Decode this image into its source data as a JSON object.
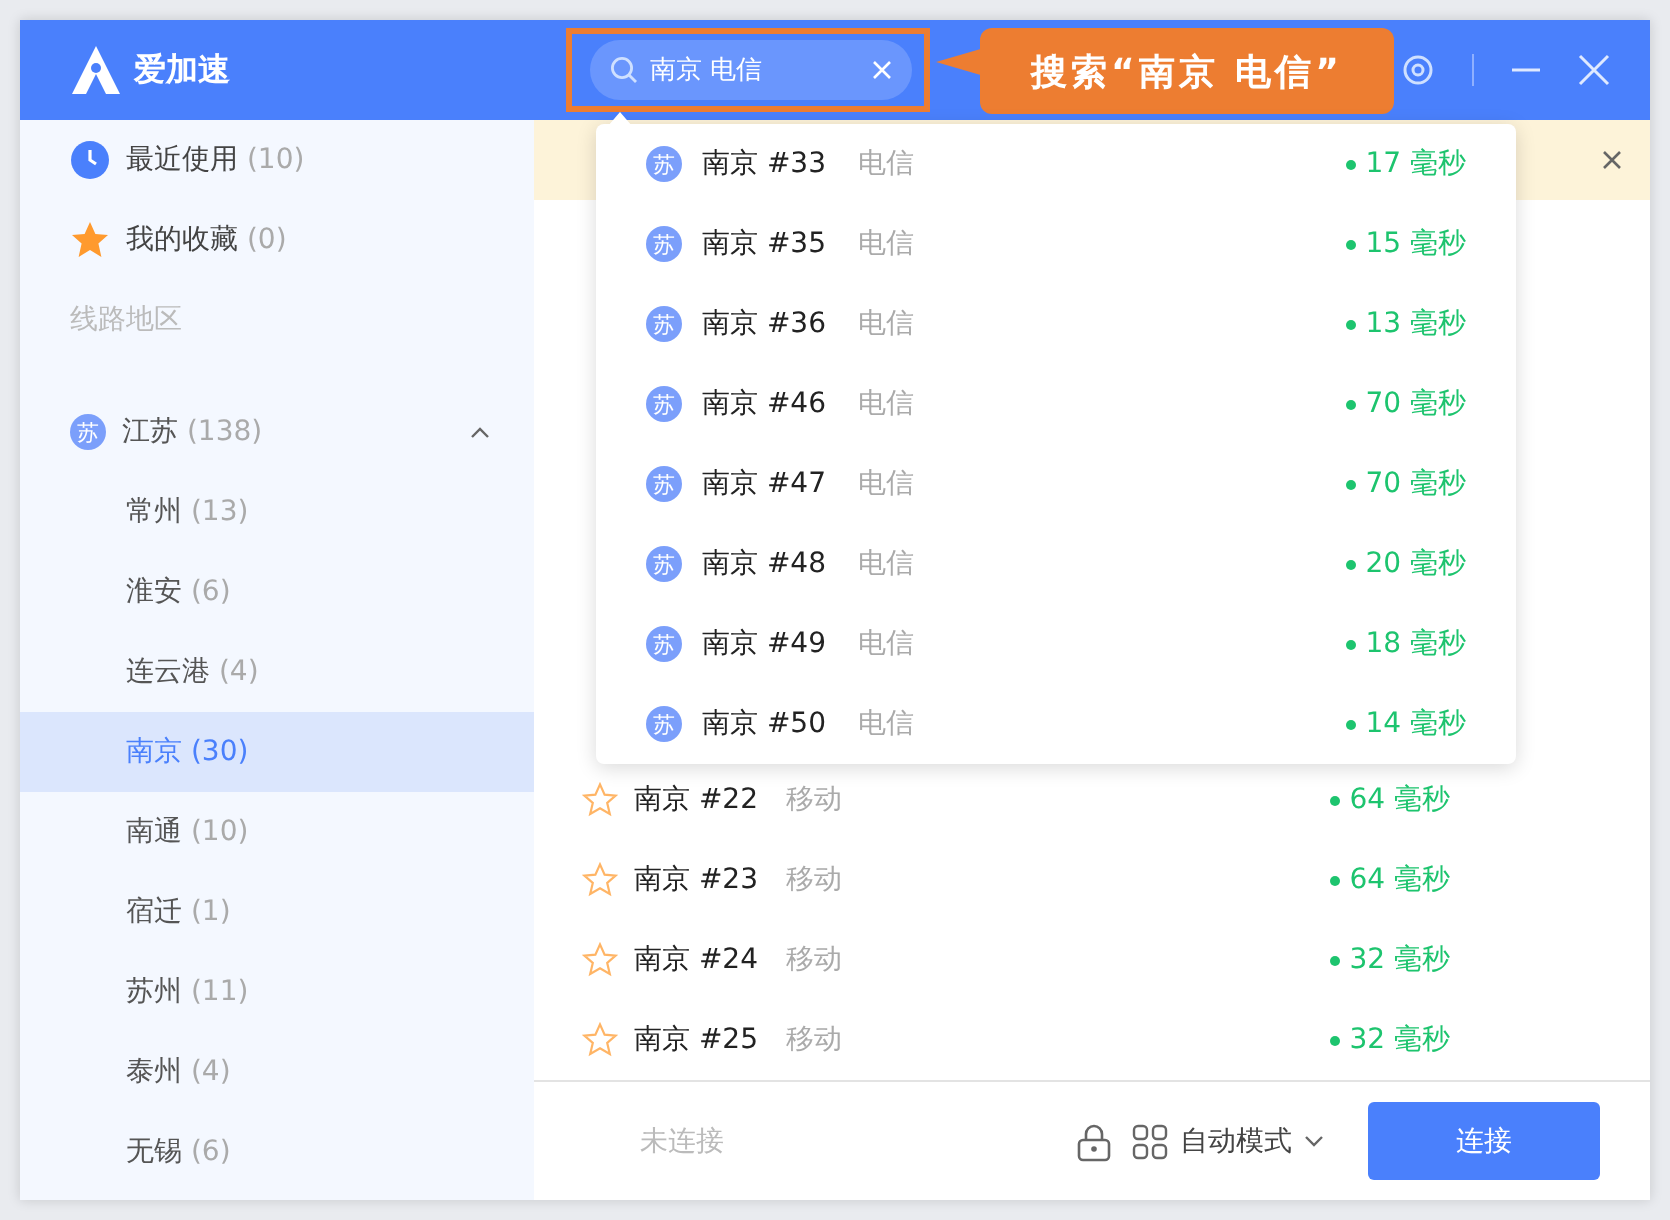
{
  "app": {
    "name": "爱加速"
  },
  "search": {
    "value": "南京 电信"
  },
  "annotation": {
    "text": "搜索“南京 电信”"
  },
  "sidebar": {
    "items": [
      {
        "kind": "recent",
        "label": "最近使用",
        "count": "(10)"
      },
      {
        "kind": "favorites",
        "label": "我的收藏",
        "count": "(0)"
      }
    ],
    "section_label": "线路地区",
    "regions": [
      {
        "badge": "苏",
        "label": "江苏",
        "count": "(138)",
        "expanded": true,
        "children": [
          {
            "label": "常州",
            "count": "(13)",
            "selected": false
          },
          {
            "label": "淮安",
            "count": "(6)",
            "selected": false
          },
          {
            "label": "连云港",
            "count": "(4)",
            "selected": false
          },
          {
            "label": "南京",
            "count": "(30)",
            "selected": true
          },
          {
            "label": "南通",
            "count": "(10)",
            "selected": false
          },
          {
            "label": "宿迁",
            "count": "(1)",
            "selected": false
          },
          {
            "label": "苏州",
            "count": "(11)",
            "selected": false
          },
          {
            "label": "泰州",
            "count": "(4)",
            "selected": false
          },
          {
            "label": "无锡",
            "count": "(6)",
            "selected": false
          }
        ]
      }
    ]
  },
  "search_results": [
    {
      "badge": "苏",
      "name": "南京 #33",
      "carrier": "电信",
      "latency": "17 毫秒"
    },
    {
      "badge": "苏",
      "name": "南京 #35",
      "carrier": "电信",
      "latency": "15 毫秒"
    },
    {
      "badge": "苏",
      "name": "南京 #36",
      "carrier": "电信",
      "latency": "13 毫秒"
    },
    {
      "badge": "苏",
      "name": "南京 #46",
      "carrier": "电信",
      "latency": "70 毫秒"
    },
    {
      "badge": "苏",
      "name": "南京 #47",
      "carrier": "电信",
      "latency": "70 毫秒"
    },
    {
      "badge": "苏",
      "name": "南京 #48",
      "carrier": "电信",
      "latency": "20 毫秒"
    },
    {
      "badge": "苏",
      "name": "南京 #49",
      "carrier": "电信",
      "latency": "18 毫秒"
    },
    {
      "badge": "苏",
      "name": "南京 #50",
      "carrier": "电信",
      "latency": "14 毫秒"
    }
  ],
  "servers": [
    {
      "name": "南京 #22",
      "carrier": "移动",
      "latency": "64 毫秒",
      "favorite": false
    },
    {
      "name": "南京 #23",
      "carrier": "移动",
      "latency": "64 毫秒",
      "favorite": false
    },
    {
      "name": "南京 #24",
      "carrier": "移动",
      "latency": "32 毫秒",
      "favorite": false
    },
    {
      "name": "南京 #25",
      "carrier": "移动",
      "latency": "32 毫秒",
      "favorite": false
    }
  ],
  "footer": {
    "status": "未连接",
    "mode": "自动模式",
    "connect_button": "连接"
  }
}
